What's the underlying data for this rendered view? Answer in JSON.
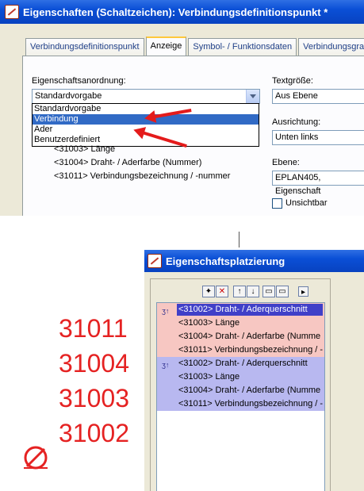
{
  "dialog_top": {
    "title": "Eigenschaften (Schaltzeichen): Verbindungsdefinitionspunkt *",
    "tabs": [
      "Verbindungsdefinitionspunkt",
      "Anzeige",
      "Symbol- / Funktionsdaten",
      "Verbindungsgrafik"
    ],
    "active_tab": "Anzeige",
    "arrangement_label": "Eigenschaftsanordnung:",
    "arrangement_value": "Standardvorgabe",
    "dropdown_options": [
      "Standardvorgabe",
      "Verbindung",
      "Ader",
      "Benutzerdefiniert"
    ],
    "dropdown_selected": "Verbindung",
    "tree_items": [
      "<31003> Länge",
      "<31004> Draht- / Aderfarbe (Nummer)",
      "<31011> Verbindungsbezeichnung / -nummer"
    ],
    "textsize_label": "Textgröße:",
    "textsize_value": "Aus Ebene",
    "alignment_label": "Ausrichtung:",
    "alignment_value": "Unten links",
    "layer_label": "Ebene:",
    "layer_value": "EPLAN405, Eigenschaft",
    "invisible_label": "Unsichtbar"
  },
  "dialog_bottom": {
    "title": "Eigenschaftsplatzierung",
    "rows": [
      {
        "text": "<31002> Draht- / Aderquerschnitt",
        "group": "pink",
        "icon": true,
        "selected": true
      },
      {
        "text": "<31003> Länge",
        "group": "pink",
        "icon": false,
        "selected": false
      },
      {
        "text": "<31004> Draht- / Aderfarbe (Numme",
        "group": "pink",
        "icon": false,
        "selected": false
      },
      {
        "text": "<31011> Verbindungsbezeichnung / -",
        "group": "pink",
        "icon": false,
        "selected": false
      },
      {
        "text": "<31002> Draht- / Aderquerschnitt",
        "group": "blue",
        "icon": true,
        "selected": false
      },
      {
        "text": "<31003> Länge",
        "group": "blue",
        "icon": false,
        "selected": false
      },
      {
        "text": "<31004> Draht- / Aderfarbe (Numme",
        "group": "blue",
        "icon": false,
        "selected": false
      },
      {
        "text": "<31011> Verbindungsbezeichnung / -",
        "group": "blue",
        "icon": false,
        "selected": false
      }
    ]
  },
  "annotations": {
    "numbers": [
      "31011",
      "31004",
      "31003",
      "31002"
    ],
    "color": "#e52222"
  }
}
